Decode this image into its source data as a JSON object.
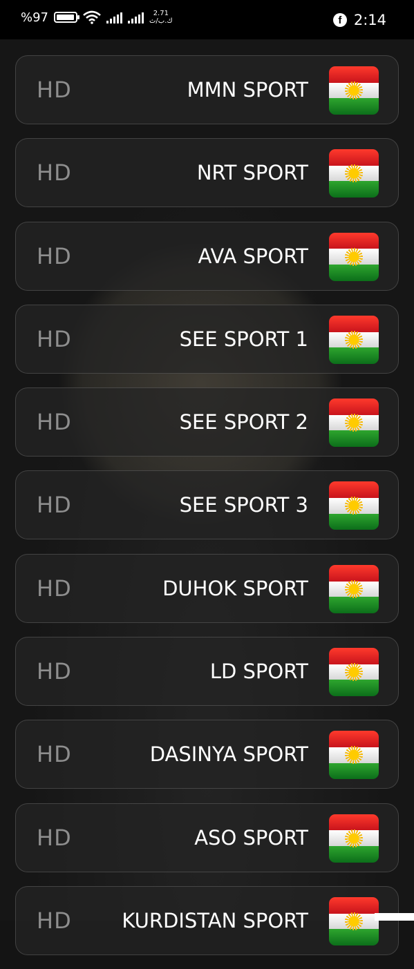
{
  "status_bar": {
    "battery_text": "%97",
    "battery_level": 0.97,
    "network_speed_value": "2.71",
    "network_speed_unit": "ك.ب/ث",
    "time": "2:14",
    "icons": [
      "battery-icon",
      "wifi-icon",
      "signal-icon",
      "signal-icon",
      "facebook-icon"
    ]
  },
  "channels": [
    {
      "quality": "HD",
      "name": "MMN SPORT",
      "flag": "kurdistan-flag-icon"
    },
    {
      "quality": "HD",
      "name": "NRT SPORT",
      "flag": "kurdistan-flag-icon"
    },
    {
      "quality": "HD",
      "name": "AVA SPORT",
      "flag": "kurdistan-flag-icon"
    },
    {
      "quality": "HD",
      "name": "SEE SPORT 1",
      "flag": "kurdistan-flag-icon"
    },
    {
      "quality": "HD",
      "name": "SEE SPORT 2",
      "flag": "kurdistan-flag-icon"
    },
    {
      "quality": "HD",
      "name": "SEE SPORT 3",
      "flag": "kurdistan-flag-icon"
    },
    {
      "quality": "HD",
      "name": "DUHOK SPORT",
      "flag": "kurdistan-flag-icon"
    },
    {
      "quality": "HD",
      "name": "LD SPORT",
      "flag": "kurdistan-flag-icon"
    },
    {
      "quality": "HD",
      "name": "DASINYA SPORT",
      "flag": "kurdistan-flag-icon"
    },
    {
      "quality": "HD",
      "name": "ASO SPORT",
      "flag": "kurdistan-flag-icon"
    },
    {
      "quality": "HD",
      "name": "KURDISTAN SPORT",
      "flag": "kurdistan-flag-icon"
    }
  ],
  "colors": {
    "background": "#161616",
    "card": "#242424",
    "quality_text": "#8e8e8e",
    "name_text": "#ffffff",
    "flag_red": "#e0231f",
    "flag_white": "#ffffff",
    "flag_green": "#1a8a22",
    "flag_sun": "#ffcb00"
  }
}
